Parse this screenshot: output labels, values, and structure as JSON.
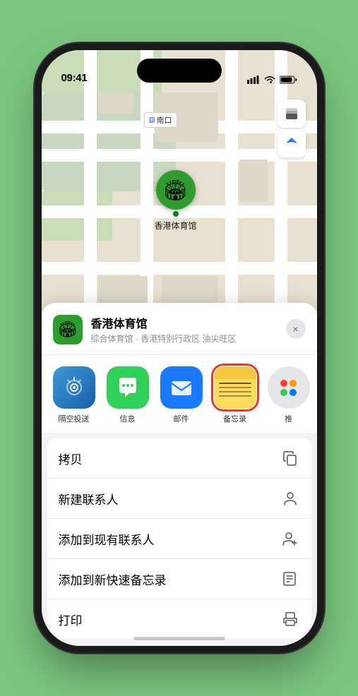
{
  "phone": {
    "time": "09:41",
    "dynamic_island": true
  },
  "map": {
    "label_text": "南口",
    "stadium_name": "香港体育馆",
    "stadium_emoji": "🏟"
  },
  "venue": {
    "name": "香港体育馆",
    "subtitle": "综合体育馆 · 香港特别行政区 油尖旺区",
    "icon_emoji": "🏟"
  },
  "share_items": [
    {
      "id": "airdrop",
      "label": "隔空投送",
      "type": "airdrop"
    },
    {
      "id": "messages",
      "label": "信息",
      "type": "messages"
    },
    {
      "id": "mail",
      "label": "邮件",
      "type": "mail"
    },
    {
      "id": "notes",
      "label": "备忘录",
      "type": "notes"
    },
    {
      "id": "more",
      "label": "推",
      "type": "more"
    }
  ],
  "actions": [
    {
      "id": "copy",
      "label": "拷贝",
      "icon": "copy"
    },
    {
      "id": "new-contact",
      "label": "新建联系人",
      "icon": "person"
    },
    {
      "id": "add-existing",
      "label": "添加到现有联系人",
      "icon": "person-add"
    },
    {
      "id": "add-note",
      "label": "添加到新快速备忘录",
      "icon": "note"
    },
    {
      "id": "print",
      "label": "打印",
      "icon": "print"
    }
  ],
  "close_label": "×",
  "map_controls": {
    "layers_icon": "🗺",
    "location_icon": "➤"
  }
}
